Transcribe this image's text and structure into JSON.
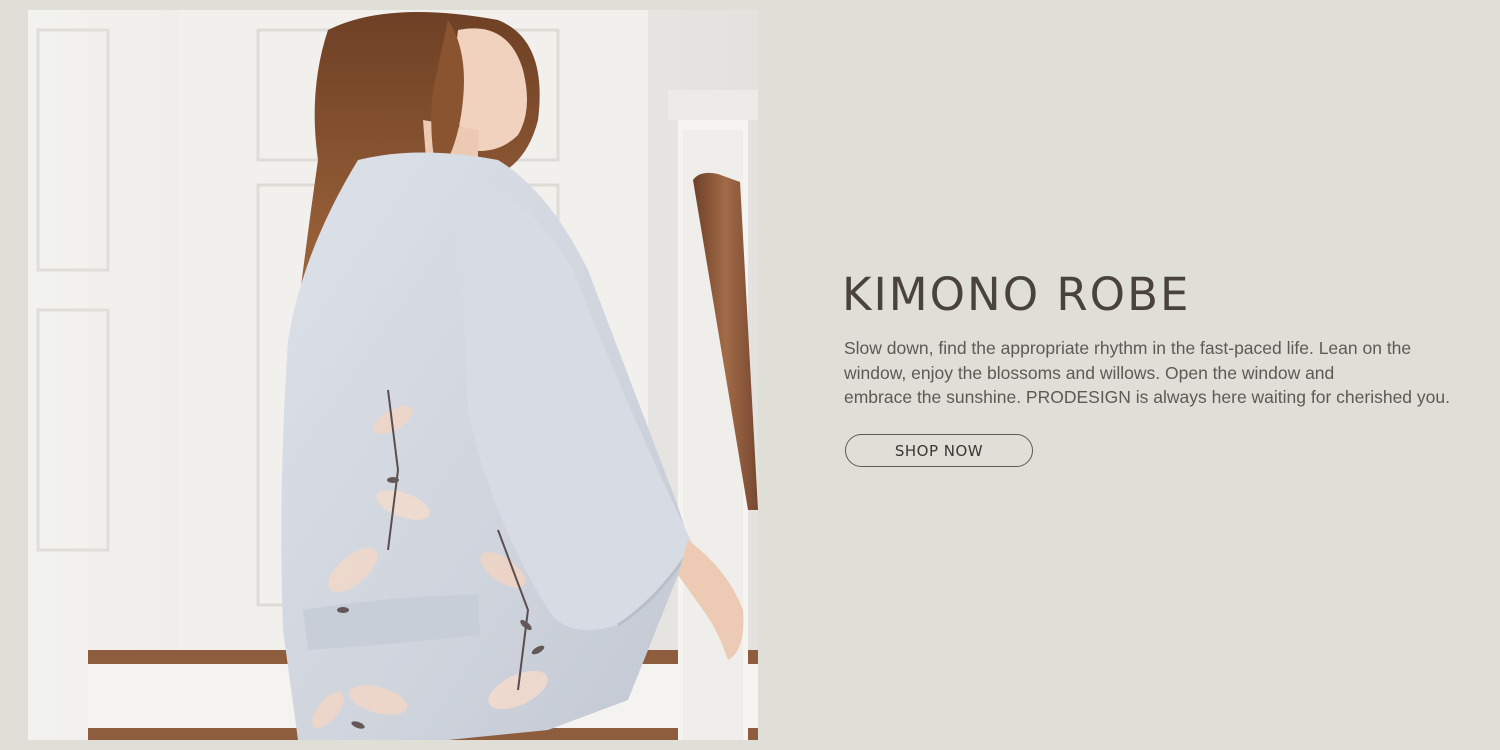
{
  "banner": {
    "title": "KIMONO ROBE",
    "description_lines": [
      "Slow down, find the appropriate rhythm in the fast-paced life. Lean on the",
      "window, enjoy the blossoms and willows. Open the window and",
      "embrace the sunshine. PRODESIGN is always here waiting for cherished you."
    ],
    "cta_label": "SHOP NOW",
    "colors": {
      "background": "#dfdfd8",
      "title": "#4a423d",
      "text": "#5e5955",
      "robe": "#d2d7df",
      "hair": "#8a5430",
      "banister": "#8b5a3a"
    },
    "photo_description_icon": "model-in-floral-kimono-photo"
  }
}
